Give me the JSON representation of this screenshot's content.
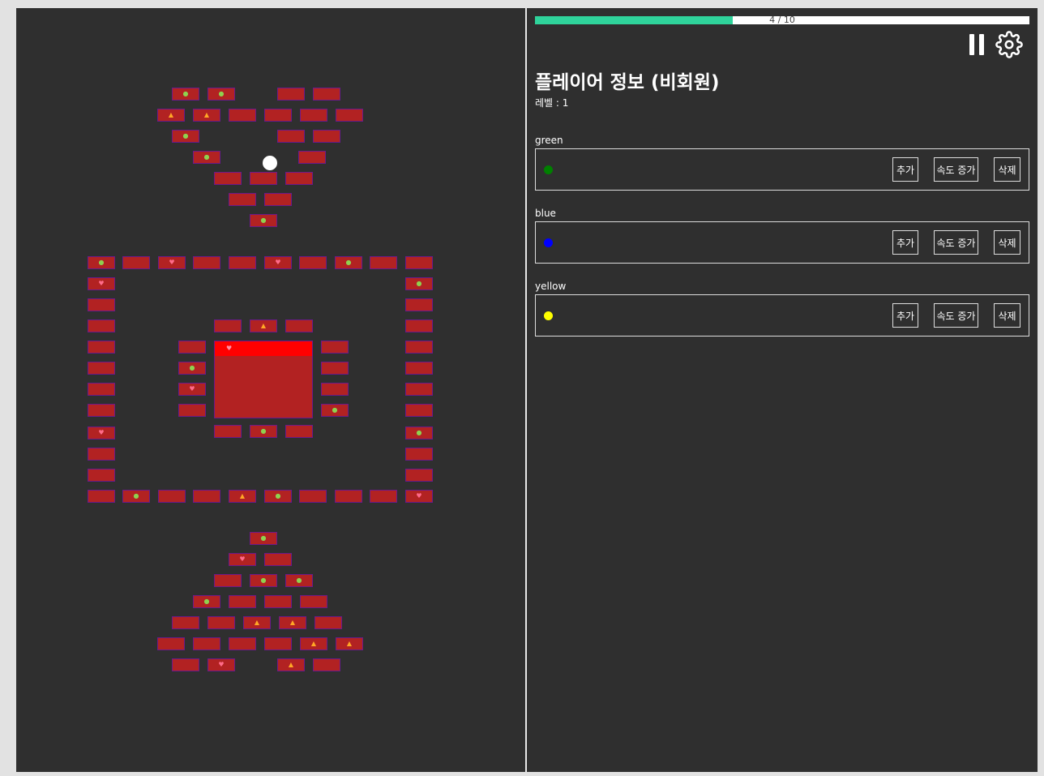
{
  "progress": {
    "label": "4 / 10",
    "value": 4,
    "max": 10,
    "fill_color": "#2fd39b"
  },
  "panel": {
    "title": "플레이어 정보 (비회원)",
    "level": "레벨 : 1"
  },
  "players": [
    {
      "name": "green",
      "color": "#008000",
      "buttons": [
        "추가",
        "속도 증가",
        "삭제"
      ]
    },
    {
      "name": "blue",
      "color": "#0000ff",
      "buttons": [
        "추가",
        "속도 증가",
        "삭제"
      ]
    },
    {
      "name": "yellow",
      "color": "#ffff00",
      "buttons": [
        "추가",
        "속도 증가",
        "삭제"
      ]
    }
  ],
  "icons": {
    "pause": "pause-icon",
    "settings": "gear-icon",
    "brick_items": [
      "green-gem-icon",
      "fire-icon",
      "heart-icon"
    ]
  },
  "colors": {
    "board_bg": "#2f2f2f",
    "brick": "#b22222",
    "brick_border": "#6a1a8a",
    "ball": "#ffffff",
    "big_block_top": "#ff0000"
  }
}
